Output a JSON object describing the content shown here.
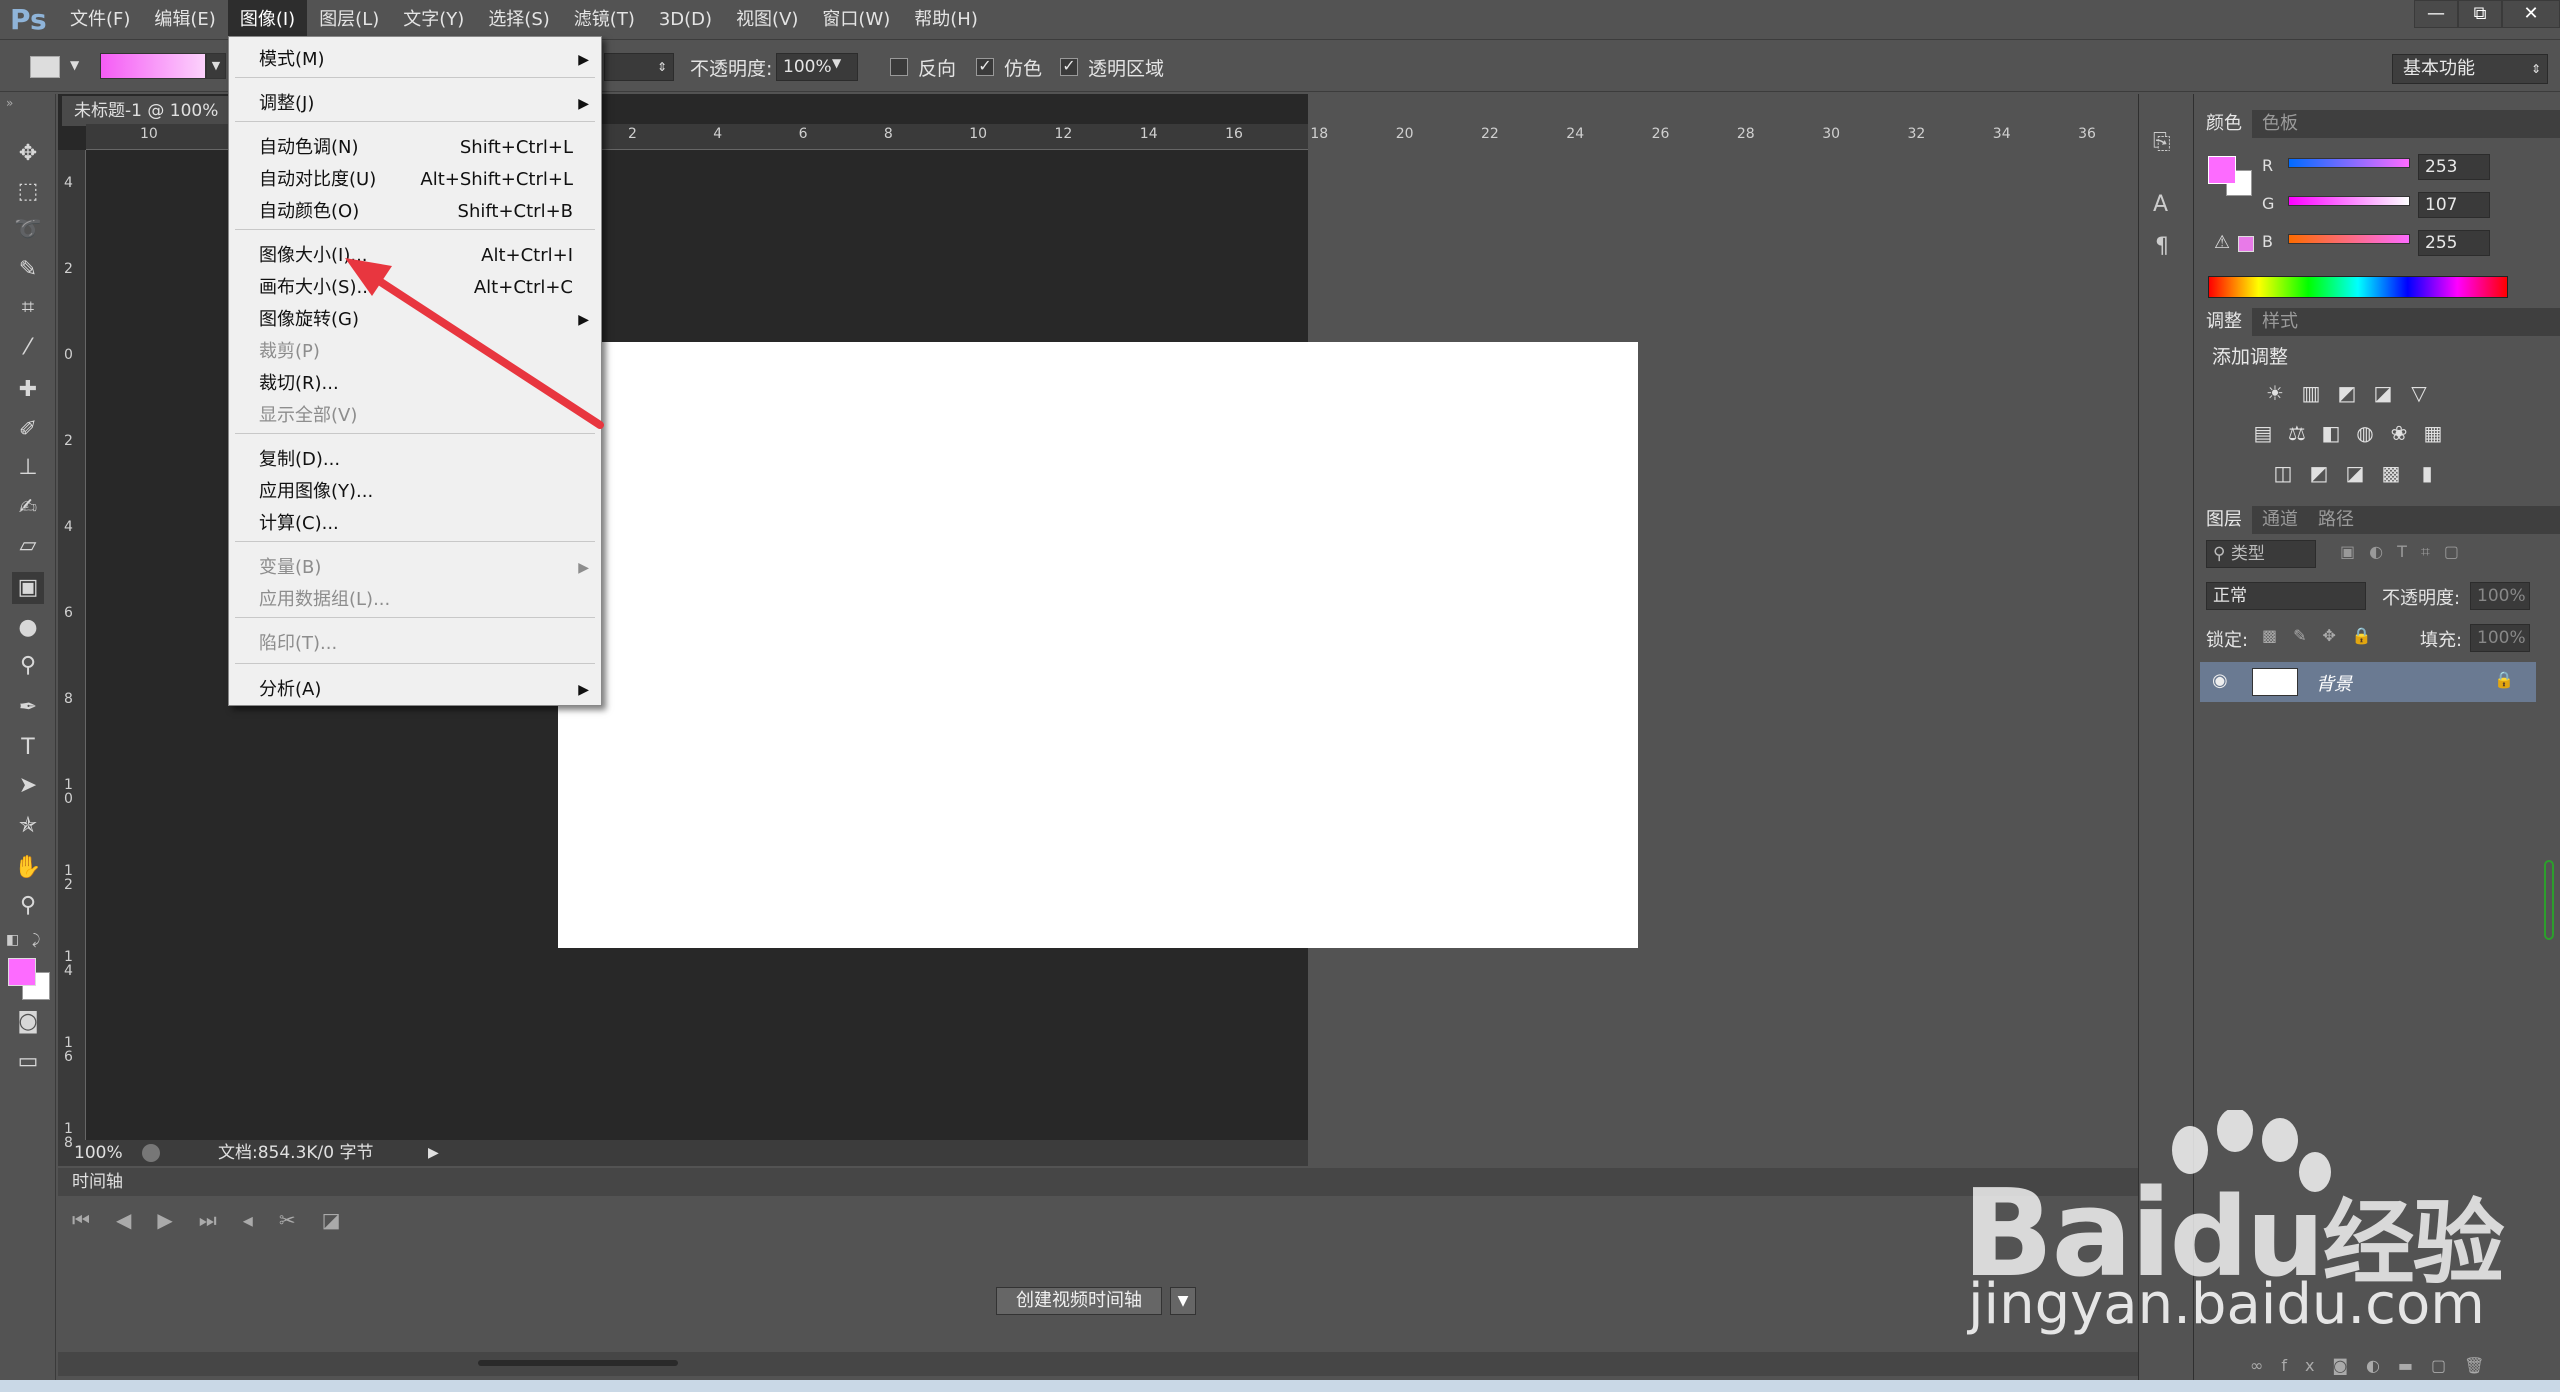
{
  "app": {
    "logo": "Ps"
  },
  "menubar": {
    "items": [
      "文件(F)",
      "编辑(E)",
      "图像(I)",
      "图层(L)",
      "文字(Y)",
      "选择(S)",
      "滤镜(T)",
      "3D(D)",
      "视图(V)",
      "窗口(W)",
      "帮助(H)"
    ],
    "active": "图像(I)"
  },
  "window_controls": {
    "minimize": "—",
    "restore": "⧉",
    "close": "✕"
  },
  "options": {
    "opacity_label": "不透明度:",
    "opacity_value": "100%",
    "reverse_label": "反向",
    "dither_label": "仿色",
    "transparency_label": "透明区域",
    "workspace": "基本功能"
  },
  "document": {
    "tab_title": "未标题-1 @ 100%",
    "zoom": "100%",
    "doc_info": "文档:854.3K/0 字节",
    "ruler_top": [
      "10",
      "2",
      "4",
      "6",
      "8",
      "10",
      "12",
      "14",
      "16",
      "18",
      "20",
      "22",
      "24",
      "26",
      "28",
      "30",
      "32",
      "34",
      "36"
    ],
    "ruler_left": [
      "4",
      "2",
      "0",
      "2",
      "4",
      "6",
      "8",
      "1 0",
      "1 2",
      "1 4",
      "1 6",
      "1 8"
    ]
  },
  "image_menu": {
    "items": [
      {
        "label": "模式(M)",
        "shortcut": "",
        "submenu": true,
        "disabled": false
      },
      {
        "label": "调整(J)",
        "shortcut": "",
        "submenu": true,
        "disabled": false
      },
      {
        "label": "自动色调(N)",
        "shortcut": "Shift+Ctrl+L",
        "submenu": false,
        "disabled": false
      },
      {
        "label": "自动对比度(U)",
        "shortcut": "Alt+Shift+Ctrl+L",
        "submenu": false,
        "disabled": false
      },
      {
        "label": "自动颜色(O)",
        "shortcut": "Shift+Ctrl+B",
        "submenu": false,
        "disabled": false
      },
      {
        "label": "图像大小(I)...",
        "shortcut": "Alt+Ctrl+I",
        "submenu": false,
        "disabled": false
      },
      {
        "label": "画布大小(S)...",
        "shortcut": "Alt+Ctrl+C",
        "submenu": false,
        "disabled": false
      },
      {
        "label": "图像旋转(G)",
        "shortcut": "",
        "submenu": true,
        "disabled": false
      },
      {
        "label": "裁剪(P)",
        "shortcut": "",
        "submenu": false,
        "disabled": true
      },
      {
        "label": "裁切(R)...",
        "shortcut": "",
        "submenu": false,
        "disabled": false
      },
      {
        "label": "显示全部(V)",
        "shortcut": "",
        "submenu": false,
        "disabled": true
      },
      {
        "label": "复制(D)...",
        "shortcut": "",
        "submenu": false,
        "disabled": false
      },
      {
        "label": "应用图像(Y)...",
        "shortcut": "",
        "submenu": false,
        "disabled": false
      },
      {
        "label": "计算(C)...",
        "shortcut": "",
        "submenu": false,
        "disabled": false
      },
      {
        "label": "变量(B)",
        "shortcut": "",
        "submenu": true,
        "disabled": true
      },
      {
        "label": "应用数据组(L)...",
        "shortcut": "",
        "submenu": false,
        "disabled": true
      },
      {
        "label": "陷印(T)...",
        "shortcut": "",
        "submenu": false,
        "disabled": true
      },
      {
        "label": "分析(A)",
        "shortcut": "",
        "submenu": true,
        "disabled": false
      }
    ]
  },
  "timeline": {
    "title": "时间轴",
    "create_button": "创建视频时间轴"
  },
  "color_panel": {
    "tabs": [
      "颜色",
      "色板"
    ],
    "r_label": "R",
    "g_label": "G",
    "b_label": "B",
    "r": "253",
    "g": "107",
    "b": "255",
    "foreground": "#fd6bff"
  },
  "adjust_panel": {
    "tabs": [
      "调整",
      "样式"
    ],
    "title": "添加调整"
  },
  "layers_panel": {
    "tabs": [
      "图层",
      "通道",
      "路径"
    ],
    "filter_kind": "类型",
    "blend_mode": "正常",
    "opacity_label": "不透明度:",
    "opacity_value": "100%",
    "lock_label": "锁定:",
    "fill_label": "填充:",
    "fill_value": "100%",
    "layer_name": "背景"
  },
  "watermark": {
    "brand_a": "Bai",
    "brand_b": "du",
    "brand_c": "经验",
    "url": "jingyan.baidu.com"
  },
  "colors": {
    "accent_arrow": "#e8363f",
    "ui_bg": "#535353",
    "canvas": "#ffffff"
  }
}
